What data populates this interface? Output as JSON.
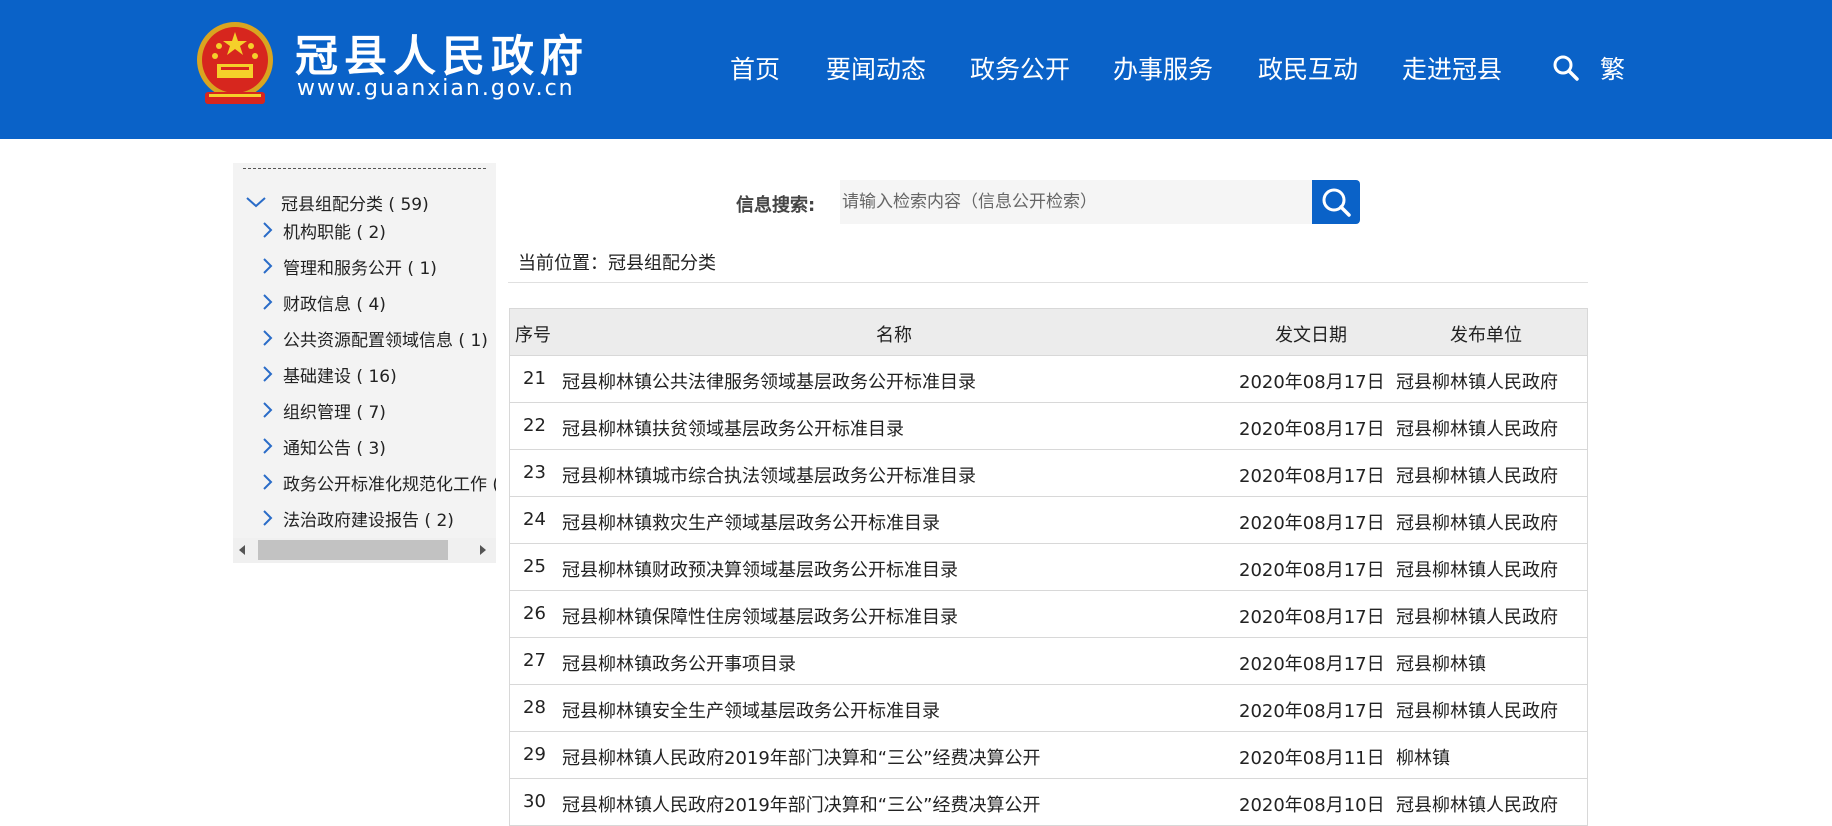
{
  "header": {
    "site_title": "冠县人民政府",
    "site_url": "www.guanxian.gov.cn",
    "nav": [
      "首页",
      "要闻动态",
      "政务公开",
      "办事服务",
      "政民互动",
      "走进冠县"
    ],
    "traditional_label": "繁",
    "colors": {
      "header_bg": "#0a62c8"
    }
  },
  "sidebar": {
    "root": {
      "label": "冠县组配分类 ( 59)"
    },
    "items": [
      {
        "label": "机构职能 ( 2)"
      },
      {
        "label": "管理和服务公开 ( 1)"
      },
      {
        "label": "财政信息 ( 4)"
      },
      {
        "label": "公共资源配置领域信息 ( 1)"
      },
      {
        "label": "基础建设 ( 16)"
      },
      {
        "label": "组织管理 ( 7)"
      },
      {
        "label": "通知公告 ( 3)"
      },
      {
        "label": "政务公开标准化规范化工作 ("
      },
      {
        "label": "法治政府建设报告 ( 2)"
      }
    ]
  },
  "search": {
    "label": "信息搜索:",
    "placeholder": "请输入检索内容（信息公开检索）"
  },
  "breadcrumb": "当前位置：冠县组配分类",
  "table": {
    "headers": {
      "no": "序号",
      "title": "名称",
      "date": "发文日期",
      "unit": "发布单位"
    },
    "rows": [
      {
        "no": "21",
        "title": "冠县柳林镇公共法律服务领域基层政务公开标准目录",
        "date": "2020年08月17日",
        "unit": "冠县柳林镇人民政府"
      },
      {
        "no": "22",
        "title": "冠县柳林镇扶贫领域基层政务公开标准目录",
        "date": "2020年08月17日",
        "unit": "冠县柳林镇人民政府"
      },
      {
        "no": "23",
        "title": "冠县柳林镇城市综合执法领域基层政务公开标准目录",
        "date": "2020年08月17日",
        "unit": "冠县柳林镇人民政府"
      },
      {
        "no": "24",
        "title": "冠县柳林镇救灾生产领域基层政务公开标准目录",
        "date": "2020年08月17日",
        "unit": "冠县柳林镇人民政府"
      },
      {
        "no": "25",
        "title": "冠县柳林镇财政预决算领域基层政务公开标准目录",
        "date": "2020年08月17日",
        "unit": "冠县柳林镇人民政府"
      },
      {
        "no": "26",
        "title": "冠县柳林镇保障性住房领域基层政务公开标准目录",
        "date": "2020年08月17日",
        "unit": "冠县柳林镇人民政府"
      },
      {
        "no": "27",
        "title": "冠县柳林镇政务公开事项目录",
        "date": "2020年08月17日",
        "unit": "冠县柳林镇"
      },
      {
        "no": "28",
        "title": "冠县柳林镇安全生产领域基层政务公开标准目录",
        "date": "2020年08月17日",
        "unit": "冠县柳林镇人民政府"
      },
      {
        "no": "29",
        "title": "冠县柳林镇人民政府2019年部门决算和“三公”经费决算公开",
        "date": "2020年08月11日",
        "unit": "柳林镇"
      },
      {
        "no": "30",
        "title": "冠县柳林镇人民政府2019年部门决算和“三公”经费决算公开",
        "date": "2020年08月10日",
        "unit": "冠县柳林镇人民政府"
      }
    ]
  }
}
